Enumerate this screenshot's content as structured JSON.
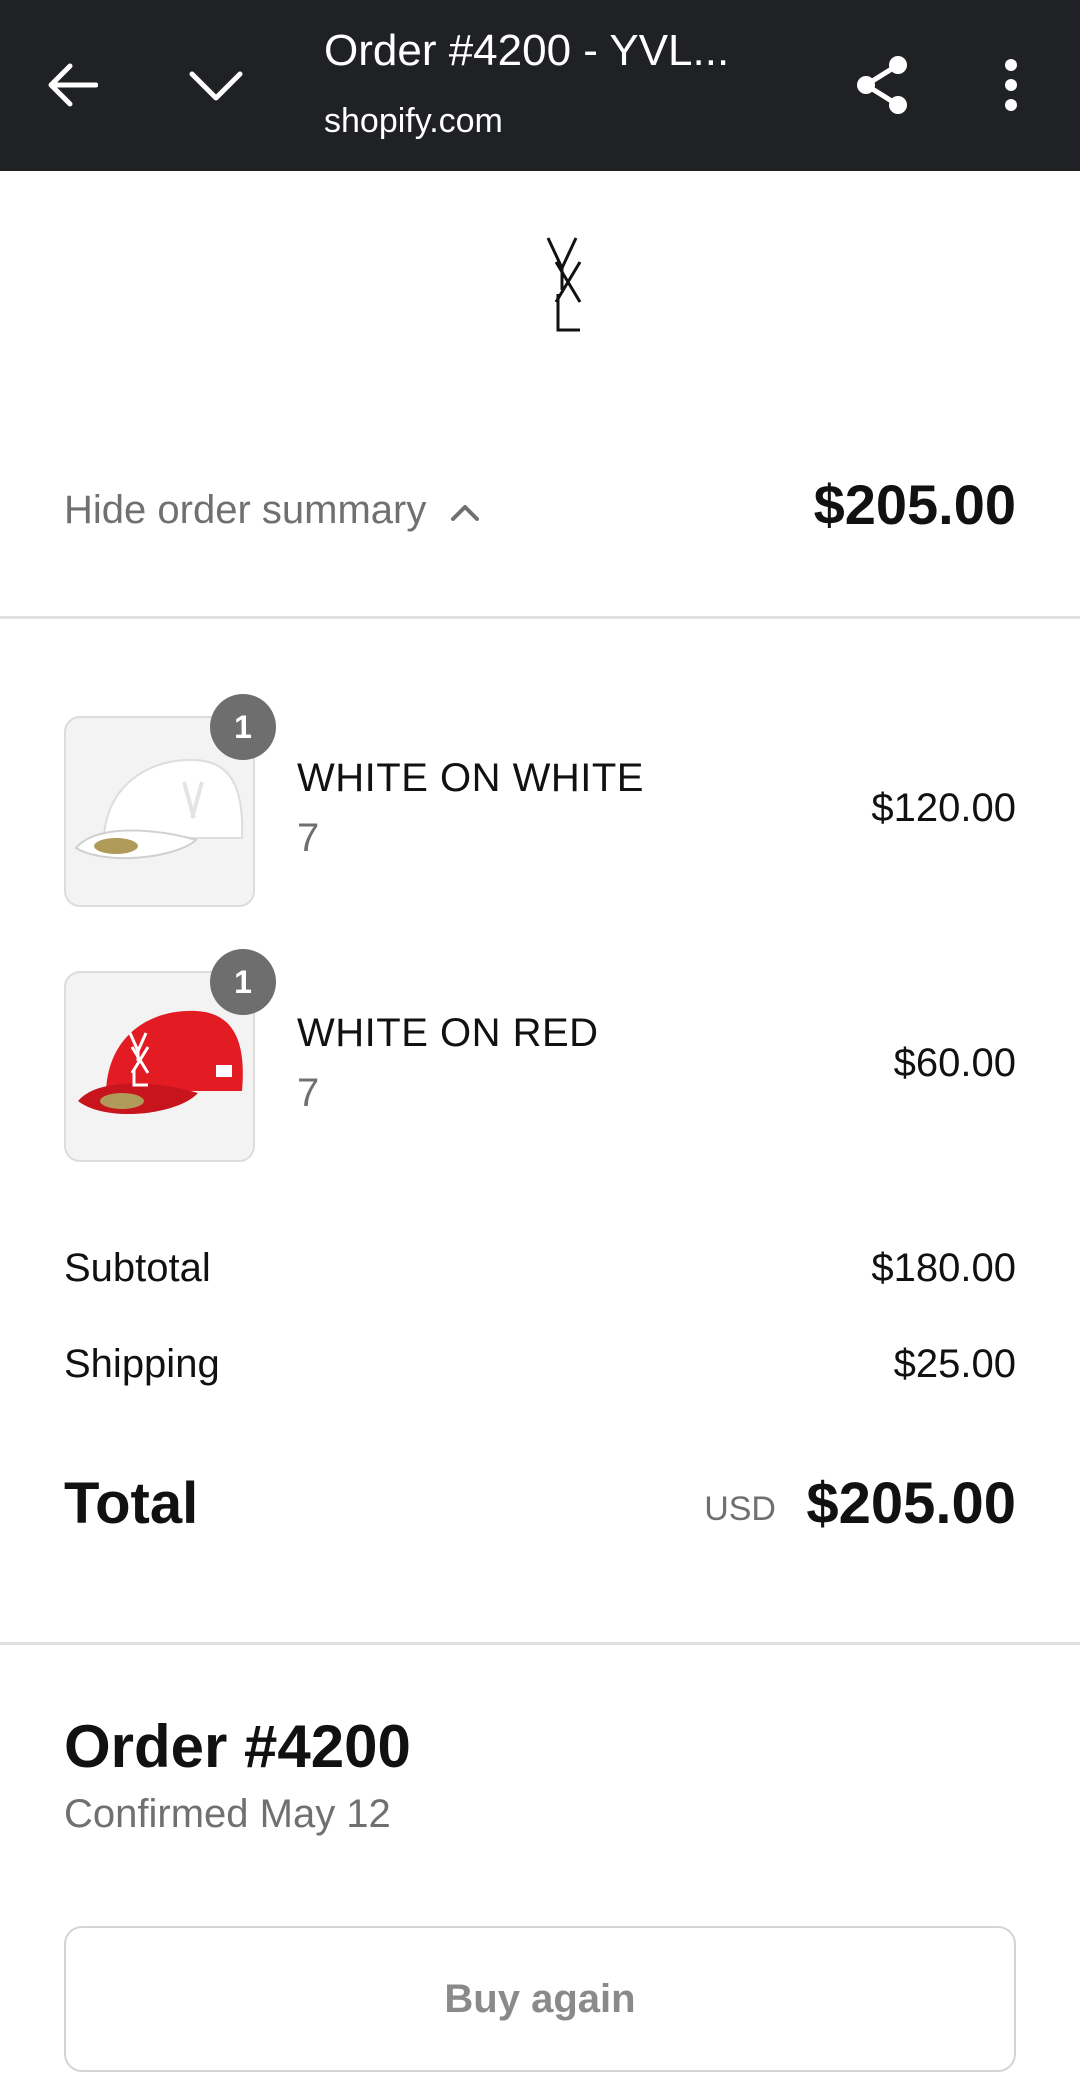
{
  "browser": {
    "title": "Order #4200 - YVL...",
    "url": "shopify.com",
    "icons": [
      "back-arrow-icon",
      "chevron-down-icon",
      "share-icon",
      "more-vert-icon"
    ]
  },
  "summary": {
    "toggle_label": "Hide order summary",
    "total": "$205.00"
  },
  "items": [
    {
      "name": "WHITE ON WHITE",
      "variant": "7",
      "price": "$120.00",
      "qty": "1",
      "color": "#f7f7f7"
    },
    {
      "name": "WHITE ON RED",
      "variant": "7",
      "price": "$60.00",
      "qty": "1",
      "color": "#e31b23"
    }
  ],
  "totals": {
    "subtotal_label": "Subtotal",
    "subtotal": "$180.00",
    "shipping_label": "Shipping",
    "shipping": "$25.00",
    "total_label": "Total",
    "currency": "USD",
    "total": "$205.00"
  },
  "order": {
    "title": "Order #4200",
    "status": "Confirmed May 12",
    "buy_again_label": "Buy again"
  },
  "colors": {
    "topbar": "#202124",
    "muted_text": "#707070",
    "badge": "#6e6e6e"
  }
}
